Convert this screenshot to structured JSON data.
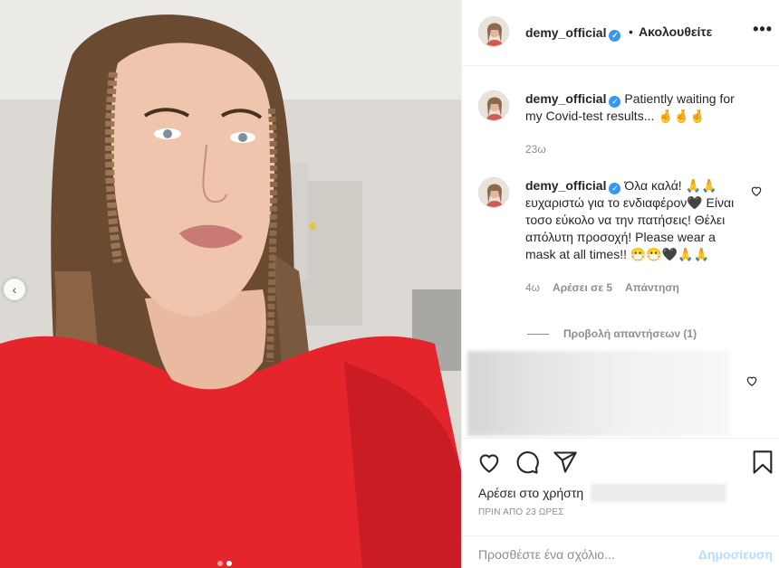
{
  "post": {
    "username": "demy_official",
    "separator": "•",
    "follow_status": "Ακολουθείτε",
    "more_icon": "more-horizontal-icon",
    "more_label": "•••"
  },
  "comments": [
    {
      "username": "demy_official",
      "text": "Patiently waiting for my Covid-test results... 🤞🤞🤞",
      "time": "23ω"
    },
    {
      "username": "demy_official",
      "text": "Όλα καλά! 🙏🙏 ευχαριστώ για το ενδιαφέρον🖤 Είναι τοσο εύκολο να την πατήσεις! Θέλει απόλυτη προσοχή! Please wear a mask at all times!! 😷😷🖤🙏🙏",
      "time": "4ω",
      "likes": "Αρέσει σε 5",
      "reply": "Απάντηση"
    }
  ],
  "view_replies": "Προβολή απαντήσεων (1)",
  "likes_prefix": "Αρέσει στο χρήστη",
  "timestamp": "ΠΡΙΝ ΑΠΟ 23 ΩΡΕΣ",
  "add_comment": {
    "placeholder": "Προσθέστε ένα σχόλιο...",
    "post_label": "Δημοσίευση"
  },
  "carousel": {
    "prev_icon": "chevron-left-icon",
    "current_index": 1,
    "total": 2
  },
  "colors": {
    "accent": "#3897f0",
    "post_disabled": "#b2dffc",
    "muted": "#8e8e8e",
    "shirt": "#e8212a"
  }
}
